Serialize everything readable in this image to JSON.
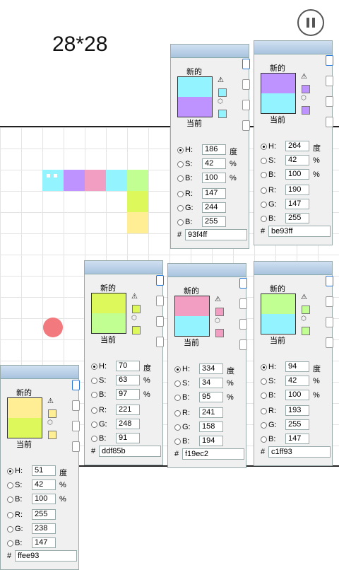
{
  "game": {
    "title": "28*28"
  },
  "snake": {
    "head_color": "#93f4ff",
    "segments": [
      "#be93ff",
      "#f19ec2",
      "#93f4ff",
      "#c1ff93",
      "#ddf85b",
      "#ddf85b",
      "#ffee93"
    ]
  },
  "food": {
    "color": "#f2797e"
  },
  "picker_labels": {
    "new": "新的",
    "current": "当前",
    "deg": "度",
    "pct": "%",
    "hash": "#"
  },
  "panels": [
    {
      "H": "186",
      "S": "42",
      "B": "100",
      "R": "147",
      "G": "244",
      "Bv": "255",
      "hex": "93f4ff",
      "new": "#93f4ff",
      "cur": "#be93ff"
    },
    {
      "H": "264",
      "S": "42",
      "B": "100",
      "R": "190",
      "G": "147",
      "Bv": "255",
      "hex": "be93ff",
      "new": "#be93ff",
      "cur": "#93f4ff"
    },
    {
      "H": "70",
      "S": "63",
      "B": "97",
      "R": "221",
      "G": "248",
      "Bv": "91",
      "hex": "ddf85b",
      "new": "#ddf85b",
      "cur": "#c1ff93"
    },
    {
      "H": "334",
      "S": "34",
      "B": "95",
      "R": "241",
      "G": "158",
      "Bv": "194",
      "hex": "f19ec2",
      "new": "#f19ec2",
      "cur": "#93f4ff"
    },
    {
      "H": "94",
      "S": "42",
      "B": "100",
      "R": "193",
      "G": "255",
      "Bv": "147",
      "hex": "c1ff93",
      "new": "#c1ff93",
      "cur": "#93f4ff"
    },
    {
      "H": "51",
      "S": "42",
      "B": "100",
      "R": "255",
      "G": "238",
      "Bv": "147",
      "hex": "ffee93",
      "new": "#ffee93",
      "cur": "#ddf85b"
    }
  ]
}
